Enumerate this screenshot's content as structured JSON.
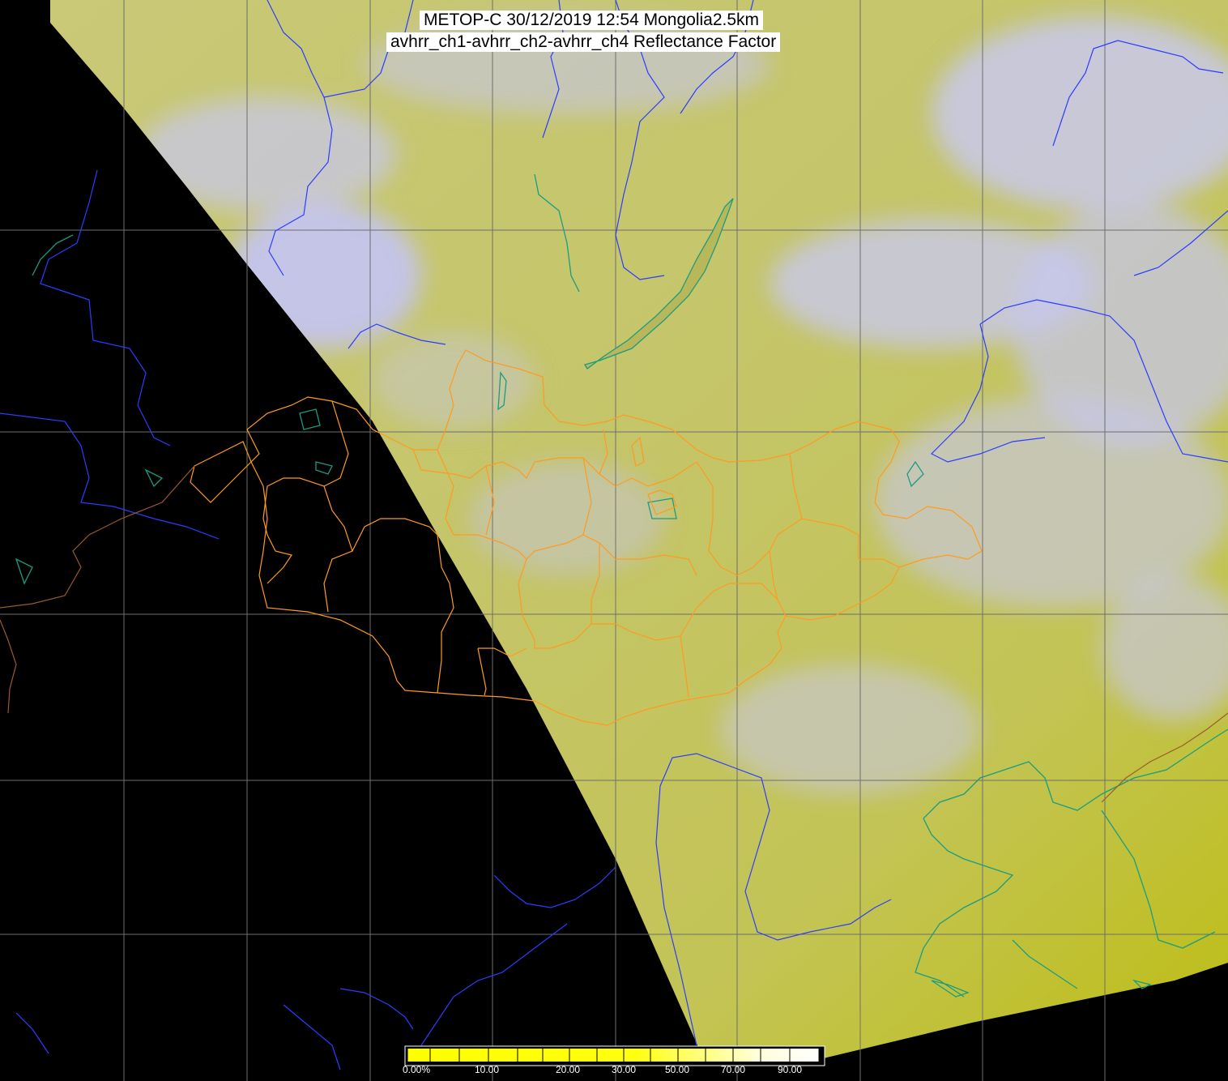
{
  "header": {
    "title": "METOP-C 30/12/2019 12:54 Mongolia2.5km",
    "subtitle": "avhrr_ch1-avhrr_ch2-avhrr_ch4 Reflectance Factor"
  },
  "legend": {
    "ticks": [
      "0.00%",
      "10.00",
      "20.00",
      "30.00",
      "50.00",
      "70.00",
      "90.00"
    ],
    "color_min": "#ffff00",
    "color_max": "#ffffff"
  },
  "colors": {
    "no_data": "#000000",
    "grid": "#6e6e6e",
    "rivers": "#2c3cff",
    "coastline": "#1a9c80",
    "mongolia_provinces": "#ff9a20",
    "cloud": "#c8c8f8",
    "ground": "#c8c860"
  }
}
